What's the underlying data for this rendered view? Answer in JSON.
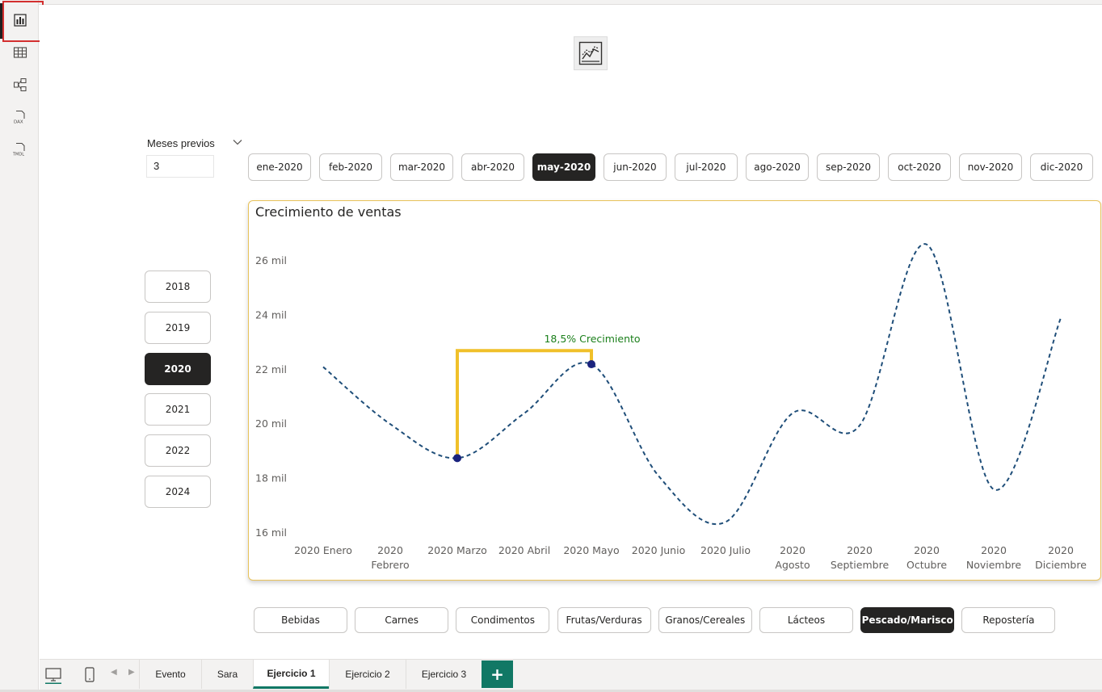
{
  "slicer": {
    "title": "Meses previos",
    "value": "3"
  },
  "months": [
    "ene-2020",
    "feb-2020",
    "mar-2020",
    "abr-2020",
    "may-2020",
    "jun-2020",
    "jul-2020",
    "ago-2020",
    "sep-2020",
    "oct-2020",
    "nov-2020",
    "dic-2020"
  ],
  "selected_month": "may-2020",
  "years": [
    "2018",
    "2019",
    "2020",
    "2021",
    "2022",
    "2024"
  ],
  "selected_year": "2020",
  "categories": [
    "Bebidas",
    "Carnes",
    "Condimentos",
    "Frutas/Verduras",
    "Granos/Cereales",
    "Lácteos",
    "Pescado/Marisco",
    "Repostería"
  ],
  "selected_category": "Pescado/Marisco",
  "tabs": [
    "Evento",
    "Sara",
    "Ejercicio 1",
    "Ejercicio 2",
    "Ejercicio 3"
  ],
  "active_tab": "Ejercicio 1",
  "add_tab_label": "+",
  "icons": {
    "rail": [
      "report-view-icon",
      "table-view-icon",
      "model-view-icon",
      "dax-query-icon",
      "tmdl-view-icon"
    ],
    "top": "line-chart-visual-icon",
    "bottom": [
      "desktop-layout-icon",
      "mobile-layout-icon"
    ]
  },
  "colors": {
    "line": "#1f4e79",
    "marker": "#1a237e",
    "annotation": "#f0c02a",
    "growth_text": "#1a7f1a",
    "accent_tab": "#117865"
  },
  "chart_data": {
    "type": "line",
    "title": "Crecimiento de ventas",
    "x": [
      "2020 Enero",
      "2020 Febrero",
      "2020 Marzo",
      "2020 Abril",
      "2020 Mayo",
      "2020 Junio",
      "2020 Julio",
      "2020 Agosto",
      "2020 Septiembre",
      "2020 Octubre",
      "2020 Noviembre",
      "2020 Diciembre"
    ],
    "x_tick_lines": [
      [
        "2020 Enero"
      ],
      [
        "2020",
        "Febrero"
      ],
      [
        "2020 Marzo"
      ],
      [
        "2020 Abril"
      ],
      [
        "2020 Mayo"
      ],
      [
        "2020 Junio"
      ],
      [
        "2020 Julio"
      ],
      [
        "2020",
        "Agosto"
      ],
      [
        "2020",
        "Septiembre"
      ],
      [
        "2020",
        "Octubre"
      ],
      [
        "2020",
        "Noviembre"
      ],
      [
        "2020",
        "Diciembre"
      ]
    ],
    "series": [
      {
        "values": [
          22100,
          20000,
          18750,
          20400,
          22200,
          18100,
          16400,
          20400,
          19950,
          26600,
          17600,
          23900
        ]
      }
    ],
    "ylim": [
      16000,
      26000
    ],
    "yticks": [
      16000,
      18000,
      20000,
      22000,
      24000,
      26000
    ],
    "ytick_labels": [
      "16 mil",
      "18 mil",
      "20 mil",
      "22 mil",
      "24 mil",
      "26 mil"
    ],
    "line_style": "dashed",
    "highlighted": [
      "2020 Marzo",
      "2020 Mayo"
    ],
    "annotation": {
      "text": "18,5% Crecimiento",
      "from": "2020 Marzo",
      "to": "2020 Mayo",
      "bracket_level": 22700
    }
  }
}
